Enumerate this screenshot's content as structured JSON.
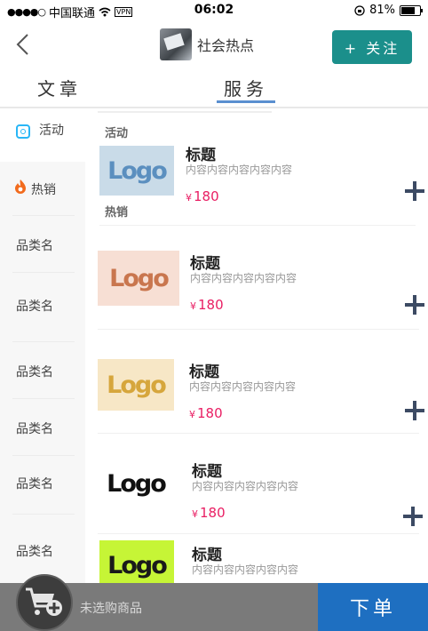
{
  "status_bar": {
    "signal": "●●●●○",
    "carrier": "中国联通",
    "wifi_icon": "wifi-icon",
    "vpn": "VPN",
    "time": "06:02",
    "lock_icon": "rotation-lock-icon",
    "battery_percent": "81%",
    "battery_level": 0.81
  },
  "header": {
    "back_icon": "chevron-left-icon",
    "title": "社会热点",
    "follow_label": "+ 关注"
  },
  "tabs": [
    {
      "label": "文章",
      "active": false
    },
    {
      "label": "服务",
      "active": true
    }
  ],
  "sidebar": {
    "items": [
      {
        "label": "活动",
        "icon": "activity-icon",
        "active": true
      },
      {
        "label": "热销",
        "icon": "fire-icon",
        "active": false
      },
      {
        "label": "品类名"
      },
      {
        "label": "品类名"
      },
      {
        "label": "品类名"
      },
      {
        "label": "品类名"
      },
      {
        "label": "品类名"
      },
      {
        "label": "品类名"
      }
    ]
  },
  "sections": {
    "activity": "活动",
    "hot": "热销"
  },
  "products": [
    {
      "logo": "Logo",
      "title": "标题",
      "desc": "内容内容内容内容内容",
      "currency": "¥",
      "price": "180",
      "logo_bg": "#c9dbe8",
      "logo_color": "#5b8fbf"
    },
    {
      "logo": "Logo",
      "title": "标题",
      "desc": "内容内容内容内容内容",
      "currency": "¥",
      "price": "180",
      "logo_bg": "#f7dfd4",
      "logo_color": "#c9764e"
    },
    {
      "logo": "Logo",
      "title": "标题",
      "desc": "内容内容内容内容内容",
      "currency": "¥",
      "price": "180",
      "logo_bg": "#f7e7c6",
      "logo_color": "#d6a63c"
    },
    {
      "logo": "Logo",
      "title": "标题",
      "desc": "内容内容内容内容内容",
      "currency": "¥",
      "price": "180",
      "logo_bg": "#ffffff",
      "logo_color": "#111111"
    },
    {
      "logo": "Logo",
      "title": "标题",
      "desc": "内容内容内容内容内容",
      "currency": "¥",
      "price": "",
      "logo_bg": "#c6f536",
      "logo_color": "#1a1a1a"
    }
  ],
  "bottom_bar": {
    "cart_icon": "cart-add-icon",
    "hint": "未选购商品",
    "order_label": "下单"
  },
  "colors": {
    "accent_teal": "#1b8f8b",
    "order_blue": "#1e6fc1",
    "price_pink": "#e91e63",
    "tab_underline": "#5a8fd0"
  }
}
